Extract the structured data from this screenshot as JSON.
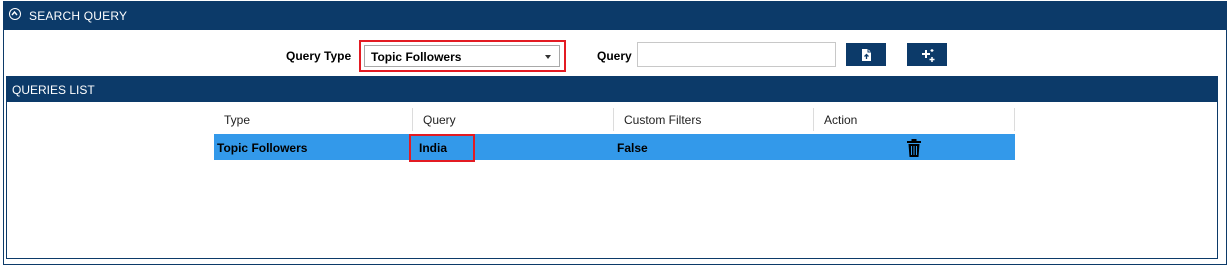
{
  "search_panel": {
    "title": "SEARCH QUERY",
    "collapse_icon": "chevron-up-circle-icon",
    "query_type_label": "Query Type",
    "query_type_value": "Topic Followers",
    "query_label": "Query",
    "query_value": "",
    "upload_icon": "upload-file-icon",
    "add_icon": "add-sparkle-icon"
  },
  "queries_list": {
    "title": "QUERIES LIST",
    "columns": [
      "Type",
      "Query",
      "Custom Filters",
      "Action"
    ],
    "rows": [
      {
        "type": "Topic Followers",
        "query": "India",
        "custom_filters": "False",
        "action_icon": "trash-icon"
      }
    ]
  },
  "colors": {
    "header_bg": "#0c3a69",
    "selected_row": "#3399ea",
    "highlight_border": "#e31b23"
  }
}
